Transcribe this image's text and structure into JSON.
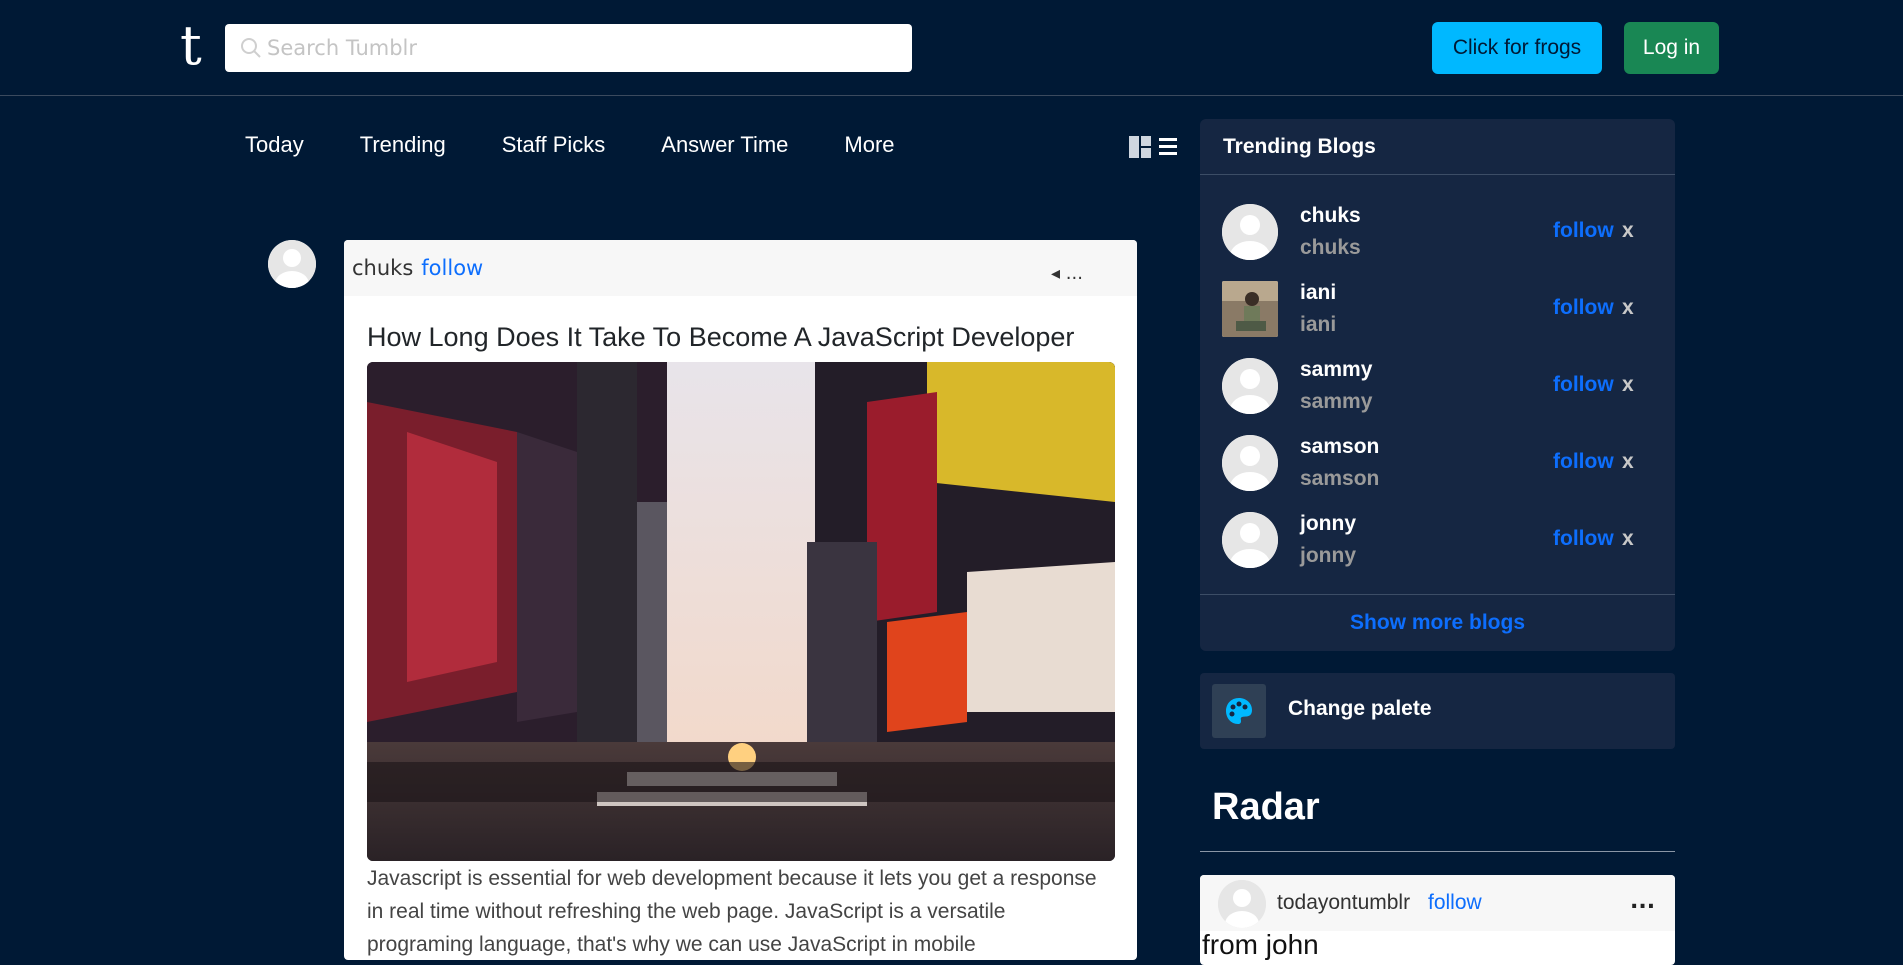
{
  "header": {
    "logo": "t",
    "search_placeholder": "Search Tumblr",
    "frogs_button": "Click for frogs",
    "login_button": "Log in"
  },
  "nav": {
    "items": [
      "Today",
      "Trending",
      "Staff Picks",
      "Answer Time",
      "More"
    ]
  },
  "post": {
    "author": "chuks",
    "follow": "follow",
    "menu": "◂ ...",
    "title": "How Long Does It Take To Become A JavaScript Developer",
    "body": "Javascript is essential for web development because it lets you get a response in real time without refreshing the web page. JavaScript is a versatile programing language, that's why we can use JavaScript in mobile"
  },
  "trending": {
    "title": "Trending Blogs",
    "blogs": [
      {
        "name": "chuks",
        "sub": "chuks",
        "follow": "follow",
        "dismiss": "x"
      },
      {
        "name": "iani",
        "sub": "iani",
        "follow": "follow",
        "dismiss": "x"
      },
      {
        "name": "sammy",
        "sub": "sammy",
        "follow": "follow",
        "dismiss": "x"
      },
      {
        "name": "samson",
        "sub": "samson",
        "follow": "follow",
        "dismiss": "x"
      },
      {
        "name": "jonny",
        "sub": "jonny",
        "follow": "follow",
        "dismiss": "x"
      }
    ],
    "show_more": "Show more blogs"
  },
  "palette": {
    "label": "Change palete"
  },
  "radar": {
    "title": "Radar",
    "author": "todayontumblr",
    "follow": "follow",
    "menu": "...",
    "body": "from john"
  },
  "colors": {
    "background": "#001935",
    "panel": "#152642",
    "accent_blue": "#0d6efd",
    "frogs": "#00b8ff",
    "login": "#198754"
  }
}
